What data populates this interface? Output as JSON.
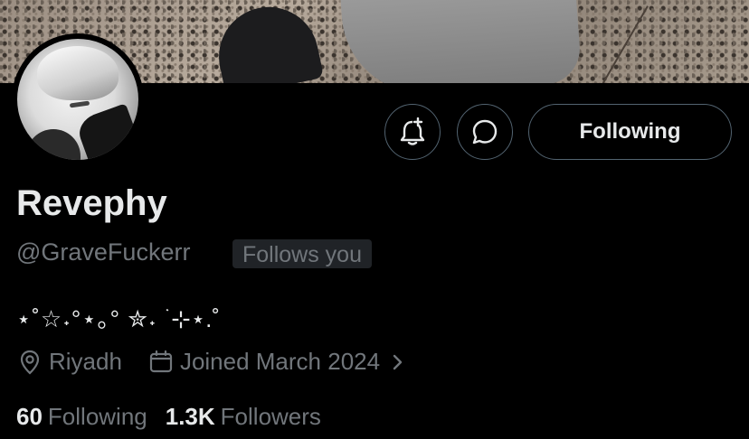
{
  "profile": {
    "display_name": "Revephy",
    "handle": "@GraveFuckerr",
    "follows_you_badge": "Follows you",
    "bio": "⋆˚☆˖°⋆｡° ✮˖ ࣪ ⊹⋆.˚",
    "location": "Riyadh",
    "joined": "Joined March 2024"
  },
  "actions": {
    "notify_icon": "bell-plus-icon",
    "message_icon": "message-bubble-icon",
    "follow_label": "Following"
  },
  "stats": {
    "following_count": "60",
    "following_label": "Following",
    "followers_count": "1.3K",
    "followers_label": "Followers"
  },
  "colors": {
    "background": "#000000",
    "primary_text": "#e7e9ea",
    "secondary_text": "#71767b",
    "border": "#536471",
    "badge_bg": "#202327"
  }
}
